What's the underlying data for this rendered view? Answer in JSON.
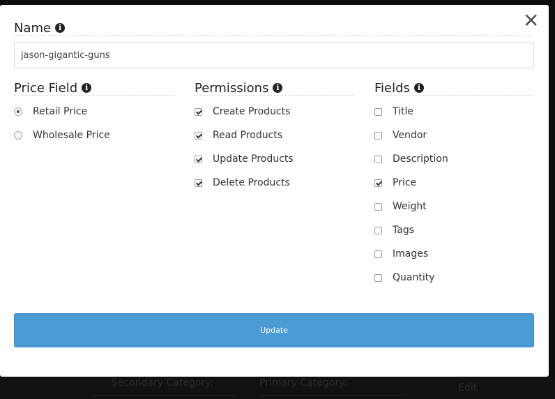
{
  "modal": {
    "close_glyph": "✕",
    "name_section": {
      "title": "Name",
      "input_value": "jason-gigantic-guns"
    },
    "price_field": {
      "title": "Price Field",
      "options": [
        {
          "label": "Retail Price",
          "selected": true
        },
        {
          "label": "Wholesale Price",
          "selected": false
        }
      ]
    },
    "permissions": {
      "title": "Permissions",
      "items": [
        {
          "label": "Create Products",
          "checked": true
        },
        {
          "label": "Read Products",
          "checked": true
        },
        {
          "label": "Update Products",
          "checked": true
        },
        {
          "label": "Delete Products",
          "checked": true
        }
      ]
    },
    "fields": {
      "title": "Fields",
      "items": [
        {
          "label": "Title",
          "checked": false
        },
        {
          "label": "Vendor",
          "checked": false
        },
        {
          "label": "Description",
          "checked": false
        },
        {
          "label": "Price",
          "checked": true
        },
        {
          "label": "Weight",
          "checked": false
        },
        {
          "label": "Tags",
          "checked": false
        },
        {
          "label": "Images",
          "checked": false
        },
        {
          "label": "Quantity",
          "checked": false
        }
      ]
    },
    "update_label": "Update",
    "info_glyph": "i"
  },
  "background": {
    "labels": [
      "Secondary Category:",
      "Primary Category:",
      "Edit"
    ]
  },
  "colors": {
    "accent": "#4a9ad4",
    "overlay": "#0d0d0d"
  }
}
